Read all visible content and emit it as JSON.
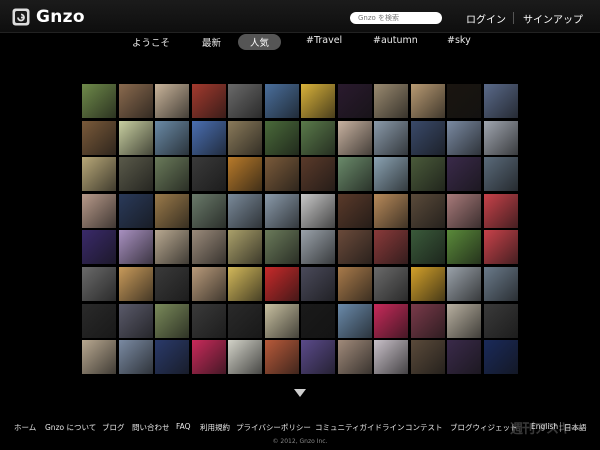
{
  "header": {
    "brand": "Gnzo",
    "search_placeholder": "Gnzo を検索",
    "login": "ログイン",
    "signup": "サインアップ"
  },
  "tabs": [
    {
      "label": "ようこそ",
      "active": false
    },
    {
      "label": "最新",
      "active": false
    },
    {
      "label": "人気",
      "active": true
    },
    {
      "label": "#Travel",
      "active": false
    },
    {
      "label": "#autumn",
      "active": false
    },
    {
      "label": "#sky",
      "active": false
    }
  ],
  "grid": {
    "rows": 8,
    "columns": 12,
    "thumb_colors": [
      "#6f8a4a",
      "#8a6a4e",
      "#c9b49a",
      "#a33a2e",
      "#6a6a6a",
      "#4a6f9c",
      "#d9b23a",
      "#2a1a2e",
      "#9a8a70",
      "#b89a72",
      "#1a1510",
      "#5a6a8a",
      "#7a5a3a",
      "#c8cfa0",
      "#6a8aa6",
      "#4a6fb2",
      "#8a7a5a",
      "#4a6a3a",
      "#5a7a4a",
      "#c8b2a0",
      "#8a9aaa",
      "#3a4a6a",
      "#7a8aa2",
      "#a0a6b0",
      "#b8a878",
      "#5a5a4a",
      "#6a7a5a",
      "#3a3a3a",
      "#b87a2a",
      "#7a5a3a",
      "#5a3a2a",
      "#6a8a6a",
      "#8aa2b2",
      "#4a5a3a",
      "#3a2a4a",
      "#5a6a7a",
      "#b89a8a",
      "#2a3a5a",
      "#9a7a4a",
      "#6a7a6a",
      "#7a8a9a",
      "#8a9aaa",
      "#c8c8c8",
      "#5a3a2a",
      "#b88a5a",
      "#5a4a3a",
      "#a87a7a",
      "#c8424a",
      "#3a2a6a",
      "#a890c0",
      "#b8a890",
      "#9a8a7a",
      "#aaa06a",
      "#6a7a5a",
      "#9aa2aa",
      "#6a4a3a",
      "#8a3a3a",
      "#3a5a3a",
      "#5a8a3a",
      "#c8424a",
      "#6a6a6a",
      "#c89a5a",
      "#3a3a3a",
      "#b89a7a",
      "#d2b85a",
      "#c82a2a",
      "#4a4a5a",
      "#a87a4a",
      "#6a6a6a",
      "#d2a02a",
      "#9aa2aa",
      "#6a7a8a",
      "#2a2a2a",
      "#5a5a6a",
      "#7a8a5a",
      "#3a3a3a",
      "#2a2a2a",
      "#c8c0a0",
      "#1a1a1a",
      "#6a8aaa",
      "#c82a5a",
      "#7a3a4a",
      "#b8b0a0",
      "#3a3a3a",
      "#b8a890",
      "#7a8aa2",
      "#2a3a6a",
      "#c82a5a",
      "#d2d2c8",
      "#b85a3a",
      "#5a4a8a",
      "#a08a7a",
      "#c8c0c8",
      "#5a4a3a",
      "#3a2a4a",
      "#1a2a5a"
    ]
  },
  "footer": {
    "links": [
      "ホーム",
      "Gnzo について",
      "ブログ",
      "問い合わせ",
      "FAQ",
      "利用規約",
      "プライバシーポリシー",
      "コミュニティガイドライン",
      "コンテスト",
      "ブログウィジェット"
    ],
    "lang_en": "English",
    "lang_ja": "日本語",
    "copyright": "© 2012, Gnzo Inc.",
    "watermark": "週刊アスキー"
  }
}
